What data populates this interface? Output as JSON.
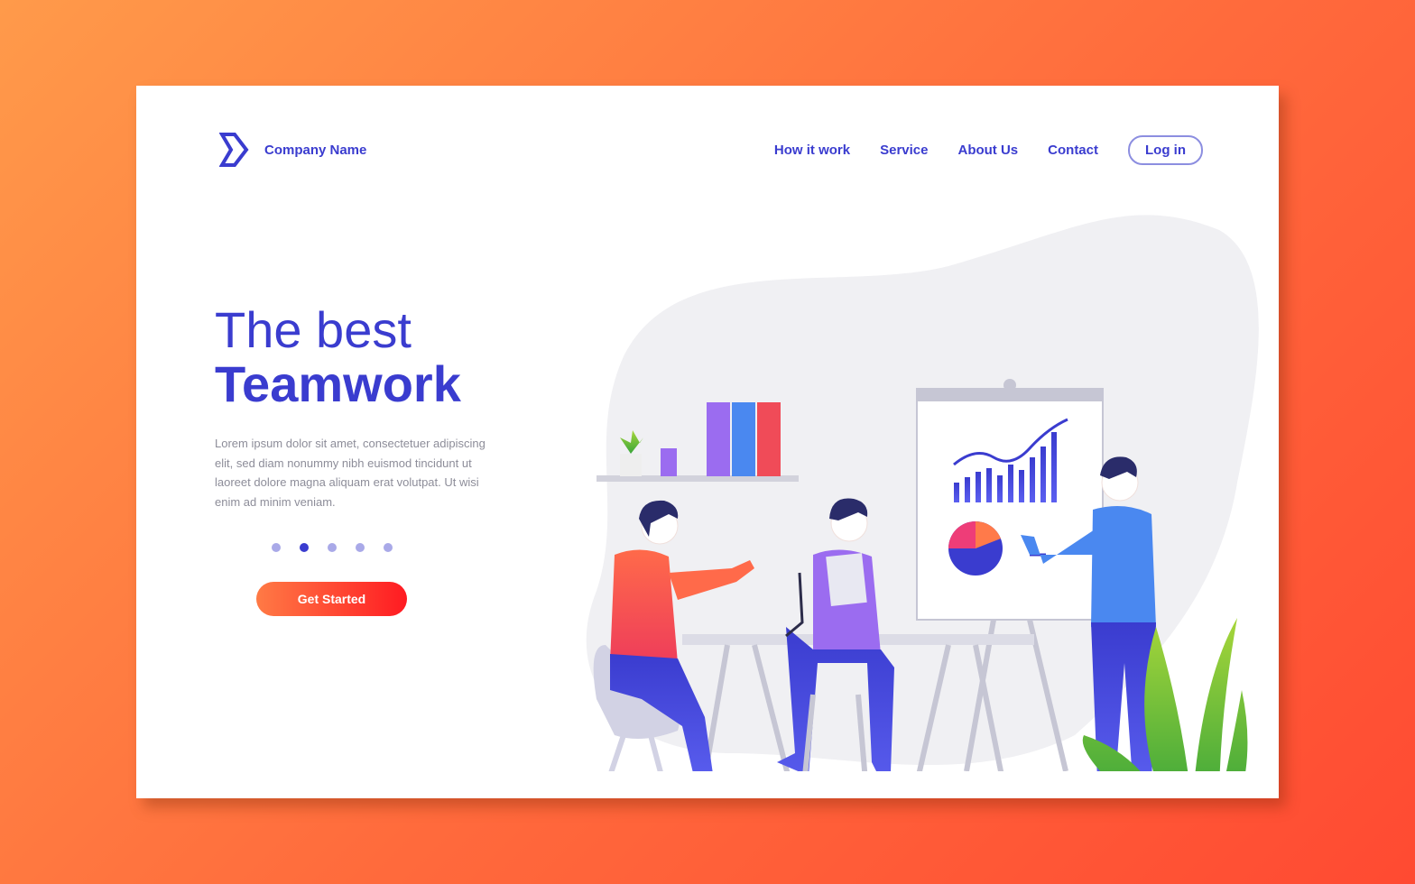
{
  "brand": {
    "name": "Company Name",
    "logo_icon": "chevron-logo-icon"
  },
  "nav": {
    "items": [
      "How it work",
      "Service",
      "About Us",
      "Contact"
    ],
    "login": "Log in"
  },
  "hero": {
    "title_line1": "The best",
    "title_line2": "Teamwork",
    "description": "Lorem ipsum dolor sit amet, consectetuer adipiscing elit, sed diam nonummy nibh euismod tincidunt ut laoreet dolore magna aliquam erat volutpat. Ut wisi enim ad minim veniam.",
    "cta": "Get Started",
    "carousel": {
      "count": 5,
      "active": 2
    }
  },
  "colors": {
    "primary": "#3a3ccf",
    "cta_start": "#ff7a45",
    "cta_end": "#ff1b22"
  }
}
